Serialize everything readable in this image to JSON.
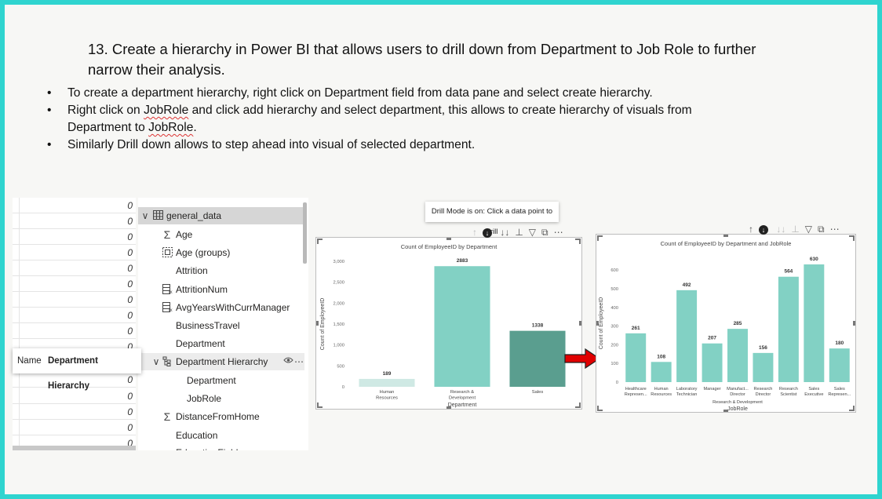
{
  "heading": "13. Create a hierarchy in Power BI that allows users to drill down from Department to Job Role to further narrow their analysis.",
  "bullets": {
    "b1": "To create a department hierarchy, right click on Department field from data pane and select create hierarchy.",
    "b2_a": "Right click on ",
    "b2_jobrole": "JobRole",
    "b2_b": " and click add hierarchy and select department, this allows  to create hierarchy of visuals from",
    "b2_c": "Department to ",
    "b2_d": ".",
    "b3": "Similarly Drill down allows to step ahead into visual of selected department."
  },
  "zero_values": [
    "0",
    "0",
    "0",
    "0",
    "0",
    "0",
    "0",
    "0",
    "0",
    "0",
    "0",
    "0",
    "0",
    "0",
    "0",
    "0"
  ],
  "data_pane": {
    "table_name": "general_data",
    "fields": {
      "age": "Age",
      "age_groups": "Age (groups)",
      "attrition": "Attrition",
      "attrition_num": "AttritionNum",
      "avg_years": "AvgYearsWithCurrManager",
      "business_travel": "BusinessTravel",
      "department": "Department",
      "hierarchy": "Department Hierarchy",
      "h_department": "Department",
      "h_jobrole": "JobRole",
      "distance": "DistanceFromHome",
      "education": "Education",
      "education_field": "EducationField"
    }
  },
  "tooltip": {
    "name_label": "Name",
    "name_value": "Department Hierarchy"
  },
  "drill_tooltip": "Drill Mode is on: Click a data point to drill",
  "icons": {
    "table": "table-icon",
    "sigma": "sigma-icon",
    "group": "group-icon",
    "calc_column": "calculated-column-icon",
    "hierarchy": "hierarchy-icon",
    "arrow": "right-arrow-icon"
  },
  "colors": {
    "bar": "#82d1c4",
    "bar_dark": "#5a9e8f",
    "bar_light": "#cfe9e4",
    "arrow": "#e00000",
    "frame": "#2fd4cf"
  },
  "chart_data": [
    {
      "type": "bar",
      "title": "Count of EmployeeID by Department",
      "xlabel": "Department",
      "ylabel": "Count of EmployeeID",
      "categories": [
        "Human Resources",
        "Research & Development",
        "Sales"
      ],
      "values": [
        189,
        2883,
        1338
      ],
      "yticks": [
        "0",
        "500",
        "1,000",
        "1,500",
        "2,000",
        "2,500",
        "3,000"
      ],
      "ylim": [
        0,
        3000
      ],
      "grid": false
    },
    {
      "type": "bar",
      "title": "Count of EmployeeID by Department and JobRole",
      "xlabel": "JobRole",
      "ylabel": "Count of EmployeeID",
      "categories": [
        "Healthcare Represen...",
        "Human Resources",
        "Laboratory Technician",
        "Manager",
        "Manufact... Director",
        "Research Director",
        "Research Scientist",
        "Sales Executive",
        "Sales Represen..."
      ],
      "group_label": "Research & Development",
      "values": [
        261,
        108,
        492,
        207,
        285,
        156,
        564,
        630,
        180
      ],
      "yticks": [
        "0",
        "100",
        "200",
        "300",
        "400",
        "500",
        "600"
      ],
      "ylim": [
        0,
        630
      ],
      "grid": false
    }
  ]
}
